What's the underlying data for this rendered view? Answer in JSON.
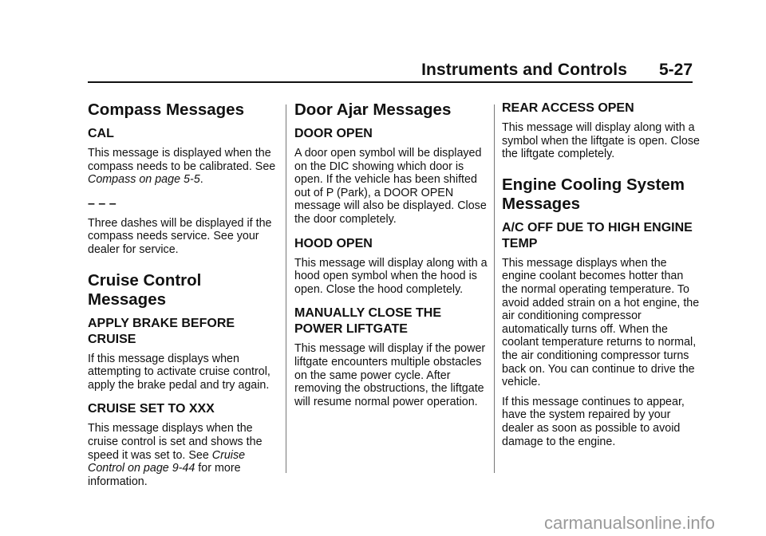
{
  "header": {
    "section": "Instruments and Controls",
    "page": "5-27"
  },
  "columns": [
    {
      "blocks": [
        {
          "type": "h2",
          "text": "Compass Messages"
        },
        {
          "type": "h3",
          "text": "CAL"
        },
        {
          "type": "p",
          "parts": [
            {
              "text": "This message is displayed when the compass needs to be calibrated. See "
            },
            {
              "text": "Compass on page 5-5",
              "italic": true
            },
            {
              "text": "."
            }
          ]
        },
        {
          "type": "h3",
          "text": "– – –"
        },
        {
          "type": "p",
          "parts": [
            {
              "text": "Three dashes will be displayed if the compass needs service. See your dealer for service."
            }
          ]
        },
        {
          "type": "h2",
          "text": "Cruise Control Messages"
        },
        {
          "type": "h3",
          "text": "APPLY BRAKE BEFORE CRUISE"
        },
        {
          "type": "p",
          "parts": [
            {
              "text": "If this message displays when attempting to activate cruise control, apply the brake pedal and try again."
            }
          ]
        },
        {
          "type": "h3",
          "text": "CRUISE SET TO XXX"
        },
        {
          "type": "p",
          "parts": [
            {
              "text": "This message displays when the cruise control is set and shows the speed it was set to. See "
            },
            {
              "text": "Cruise Control on page 9-44",
              "italic": true
            },
            {
              "text": " for more information."
            }
          ]
        }
      ]
    },
    {
      "blocks": [
        {
          "type": "h2",
          "text": "Door Ajar Messages"
        },
        {
          "type": "h3",
          "text": "DOOR OPEN"
        },
        {
          "type": "p",
          "parts": [
            {
              "text": "A door open symbol will be displayed on the DIC showing which door is open. If the vehicle has been shifted out of P (Park), a DOOR OPEN message will also be displayed. Close the door completely."
            }
          ]
        },
        {
          "type": "h3",
          "text": "HOOD OPEN"
        },
        {
          "type": "p",
          "parts": [
            {
              "text": "This message will display along with a hood open symbol when the hood is open. Close the hood completely."
            }
          ]
        },
        {
          "type": "h3",
          "text": "MANUALLY CLOSE THE POWER LIFTGATE"
        },
        {
          "type": "p",
          "parts": [
            {
              "text": "This message will display if the power liftgate encounters multiple obstacles on the same power cycle. After removing the obstructions, the liftgate will resume normal power operation."
            }
          ]
        }
      ]
    },
    {
      "blocks": [
        {
          "type": "h3",
          "text": "REAR ACCESS OPEN"
        },
        {
          "type": "p",
          "parts": [
            {
              "text": "This message will display along with a symbol when the liftgate is open. Close the liftgate completely."
            }
          ]
        },
        {
          "type": "h2",
          "text": "Engine Cooling System Messages"
        },
        {
          "type": "h3",
          "text": "A/C OFF DUE TO HIGH ENGINE TEMP"
        },
        {
          "type": "p",
          "parts": [
            {
              "text": "This message displays when the engine coolant becomes hotter than the normal operating temperature. To avoid added strain on a hot engine, the air conditioning compressor automatically turns off. When the coolant temperature returns to normal, the air conditioning compressor turns back on. You can continue to drive the vehicle."
            }
          ]
        },
        {
          "type": "p",
          "parts": [
            {
              "text": "If this message continues to appear, have the system repaired by your dealer as soon as possible to avoid damage to the engine."
            }
          ]
        }
      ]
    }
  ],
  "watermark": "carmanualsonline.info"
}
